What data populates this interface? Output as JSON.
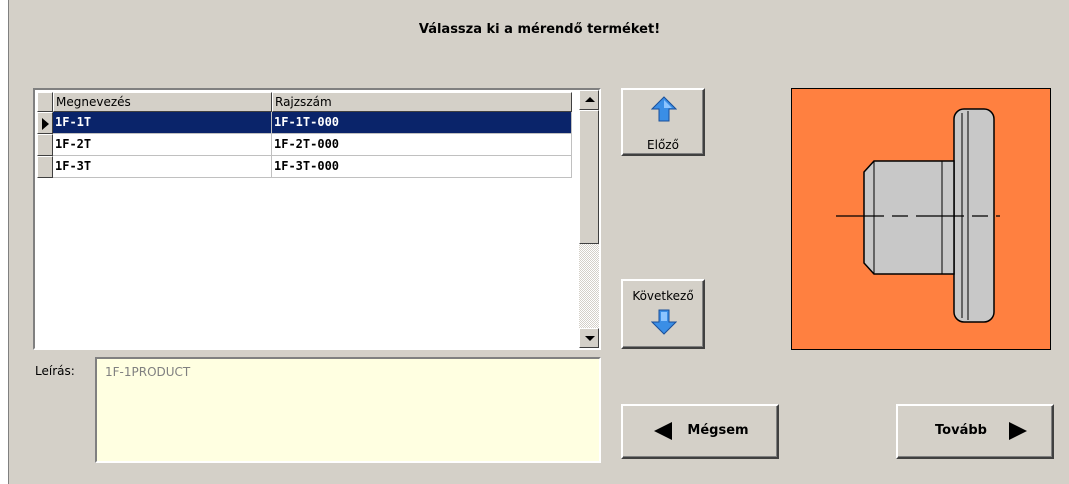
{
  "title": "Válassza ki a mérendő terméket!",
  "grid": {
    "columns": [
      "Megnevezés",
      "Rajzszám"
    ],
    "rows": [
      {
        "name": "1F-1T",
        "drawing": "1F-1T-000",
        "selected": true
      },
      {
        "name": "1F-2T",
        "drawing": "1F-2T-000",
        "selected": false
      },
      {
        "name": "1F-3T",
        "drawing": "1F-3T-000",
        "selected": false
      }
    ]
  },
  "description": {
    "label": "Leírás:",
    "value": "1F-1PRODUCT"
  },
  "buttons": {
    "prev": "Előző",
    "next": "Következő",
    "cancel": "Mégsem",
    "forward": "Tovább"
  },
  "colors": {
    "picture_bg": "#ff8040",
    "selection": "#0a246a",
    "arrow_blue": "#3a8ee6",
    "memo_bg": "#ffffe1"
  },
  "icons": [
    "arrow-up-icon",
    "arrow-down-icon",
    "arrow-left-icon",
    "arrow-right-icon"
  ]
}
